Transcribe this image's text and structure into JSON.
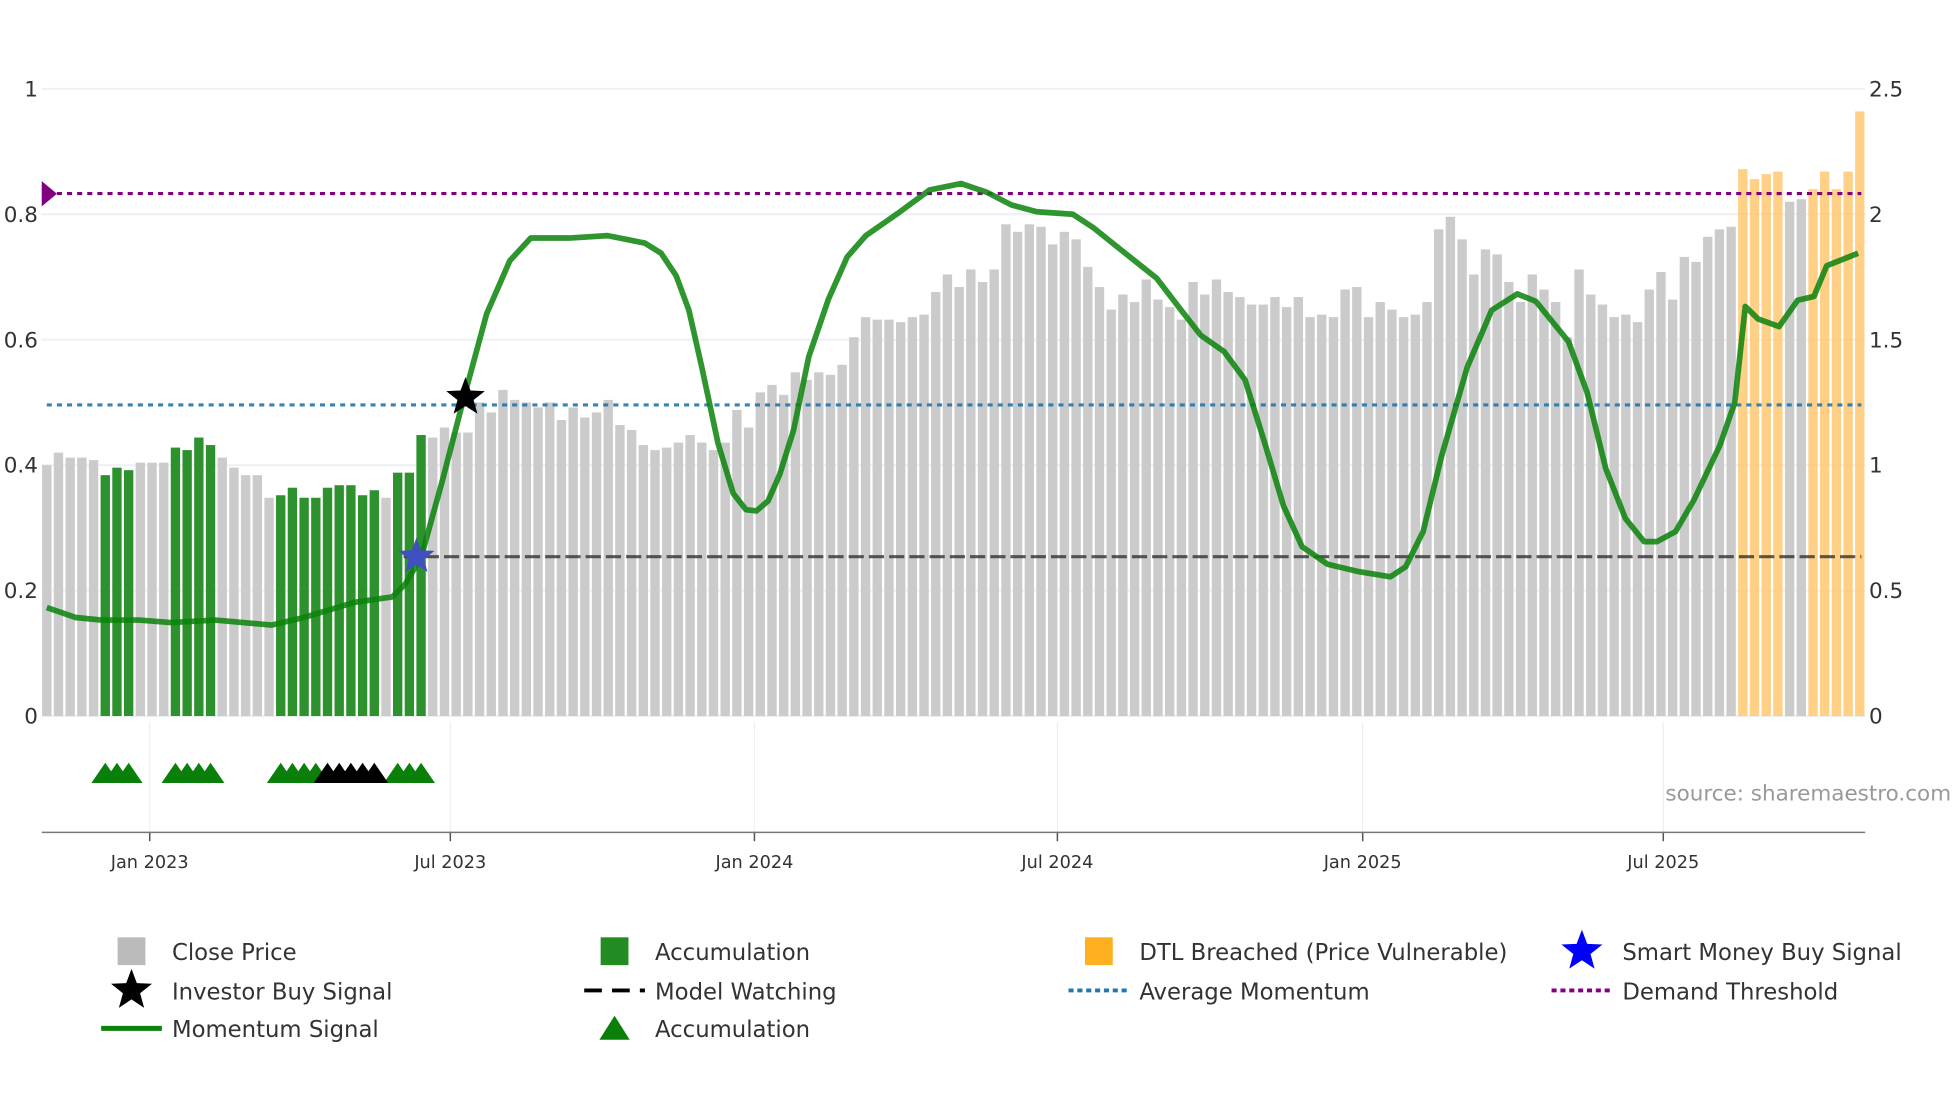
{
  "chart_data": {
    "type": "bar",
    "title": "",
    "x_unit": "week index",
    "x_ticks": [
      {
        "label": "Jan 2023",
        "index": 8.8
      },
      {
        "label": "Jul 2023",
        "index": 34.5
      },
      {
        "label": "Jan 2024",
        "index": 60.5
      },
      {
        "label": "Jul 2024",
        "index": 86.4
      },
      {
        "label": "Jan 2025",
        "index": 112.5
      },
      {
        "label": "Jul 2025",
        "index": 138.2
      }
    ],
    "y_left": {
      "ticks": [
        "0",
        "0.2",
        "0.4",
        "0.6",
        "0.8",
        "1"
      ],
      "values": [
        0,
        0.2,
        0.4,
        0.6,
        0.8,
        1
      ],
      "range": [
        0,
        1
      ]
    },
    "y_right": {
      "ticks": [
        "0",
        "0.5",
        "1",
        "1.5",
        "2",
        "2.5"
      ],
      "values": [
        0,
        0.5,
        1,
        1.5,
        2,
        2.5
      ],
      "range": [
        0,
        2.5
      ]
    },
    "close_price": [
      1.0,
      1.05,
      1.03,
      1.03,
      1.02,
      0.96,
      0.99,
      0.98,
      1.01,
      1.01,
      1.01,
      1.07,
      1.06,
      1.11,
      1.08,
      1.03,
      0.99,
      0.96,
      0.96,
      0.87,
      0.88,
      0.91,
      0.87,
      0.87,
      0.91,
      0.92,
      0.92,
      0.88,
      0.9,
      0.87,
      0.97,
      0.97,
      1.12,
      1.11,
      1.15,
      1.13,
      1.13,
      1.25,
      1.21,
      1.3,
      1.26,
      1.25,
      1.23,
      1.25,
      1.18,
      1.23,
      1.19,
      1.21,
      1.26,
      1.16,
      1.14,
      1.08,
      1.06,
      1.07,
      1.09,
      1.12,
      1.09,
      1.06,
      1.09,
      1.22,
      1.15,
      1.29,
      1.32,
      1.28,
      1.37,
      1.34,
      1.37,
      1.36,
      1.4,
      1.51,
      1.59,
      1.58,
      1.58,
      1.57,
      1.59,
      1.6,
      1.69,
      1.76,
      1.71,
      1.78,
      1.73,
      1.78,
      1.96,
      1.93,
      1.96,
      1.95,
      1.88,
      1.93,
      1.9,
      1.79,
      1.71,
      1.62,
      1.68,
      1.65,
      1.74,
      1.66,
      1.63,
      1.58,
      1.73,
      1.68,
      1.74,
      1.69,
      1.67,
      1.64,
      1.64,
      1.67,
      1.63,
      1.67,
      1.59,
      1.6,
      1.59,
      1.7,
      1.71,
      1.59,
      1.65,
      1.62,
      1.59,
      1.6,
      1.65,
      1.94,
      1.99,
      1.9,
      1.76,
      1.86,
      1.84,
      1.73,
      1.65,
      1.76,
      1.7,
      1.65,
      1.51,
      1.78,
      1.68,
      1.64,
      1.59,
      1.6,
      1.57,
      1.7,
      1.77,
      1.66,
      1.83,
      1.81,
      1.91,
      1.94,
      1.95,
      2.18,
      2.14,
      2.16,
      2.17,
      2.05,
      2.06,
      2.1,
      2.17,
      2.1,
      2.17,
      2.41
    ],
    "accumulation_bar_indices": [
      5,
      6,
      7,
      11,
      12,
      13,
      14,
      20,
      21,
      22,
      23,
      24,
      25,
      26,
      27,
      28,
      30,
      31,
      32
    ],
    "dtl_breached_bar_indices": [
      145,
      146,
      147,
      148,
      151,
      152,
      153,
      154,
      155
    ],
    "momentum": [
      [
        0,
        0.173
      ],
      [
        2.5,
        0.157
      ],
      [
        4.7,
        0.153
      ],
      [
        7.9,
        0.153
      ],
      [
        10.7,
        0.149
      ],
      [
        14.5,
        0.153
      ],
      [
        19.3,
        0.145
      ],
      [
        22.1,
        0.157
      ],
      [
        26.4,
        0.181
      ],
      [
        29.7,
        0.19
      ],
      [
        30.8,
        0.21
      ],
      [
        32.2,
        0.254
      ],
      [
        34,
        0.375
      ],
      [
        35.8,
        0.504
      ],
      [
        37.8,
        0.641
      ],
      [
        39.8,
        0.726
      ],
      [
        41.6,
        0.762
      ],
      [
        44.9,
        0.762
      ],
      [
        48.2,
        0.766
      ],
      [
        51.4,
        0.754
      ],
      [
        52.8,
        0.738
      ],
      [
        54.1,
        0.702
      ],
      [
        55.2,
        0.647
      ],
      [
        56.3,
        0.556
      ],
      [
        57.7,
        0.435
      ],
      [
        59,
        0.355
      ],
      [
        60.1,
        0.329
      ],
      [
        61,
        0.327
      ],
      [
        62,
        0.343
      ],
      [
        63,
        0.385
      ],
      [
        64.2,
        0.456
      ],
      [
        65.5,
        0.573
      ],
      [
        67.2,
        0.665
      ],
      [
        68.8,
        0.732
      ],
      [
        70.4,
        0.766
      ],
      [
        73.2,
        0.802
      ],
      [
        75.9,
        0.839
      ],
      [
        78.6,
        0.849
      ],
      [
        80.8,
        0.835
      ],
      [
        82.9,
        0.815
      ],
      [
        85.1,
        0.804
      ],
      [
        88.2,
        0.8
      ],
      [
        90,
        0.778
      ],
      [
        92.7,
        0.738
      ],
      [
        95.4,
        0.698
      ],
      [
        97.6,
        0.645
      ],
      [
        99.2,
        0.607
      ],
      [
        101.2,
        0.581
      ],
      [
        103,
        0.536
      ],
      [
        104.7,
        0.435
      ],
      [
        106.3,
        0.335
      ],
      [
        107.9,
        0.27
      ],
      [
        110.1,
        0.242
      ],
      [
        112.8,
        0.23
      ],
      [
        115.5,
        0.222
      ],
      [
        116.8,
        0.238
      ],
      [
        118.3,
        0.294
      ],
      [
        119.9,
        0.415
      ],
      [
        122.1,
        0.556
      ],
      [
        124.2,
        0.647
      ],
      [
        126.4,
        0.673
      ],
      [
        128,
        0.661
      ],
      [
        130.8,
        0.597
      ],
      [
        132.4,
        0.516
      ],
      [
        134,
        0.395
      ],
      [
        135.7,
        0.315
      ],
      [
        137.3,
        0.278
      ],
      [
        138.4,
        0.278
      ],
      [
        140,
        0.294
      ],
      [
        141.6,
        0.345
      ],
      [
        143.8,
        0.431
      ],
      [
        145.1,
        0.5
      ],
      [
        146,
        0.653
      ],
      [
        147.1,
        0.633
      ],
      [
        148.9,
        0.621
      ],
      [
        150.5,
        0.663
      ],
      [
        151.9,
        0.669
      ],
      [
        153,
        0.718
      ],
      [
        155.7,
        0.738
      ]
    ],
    "demand_threshold": 0.833,
    "average_momentum": 0.496,
    "model_watching": {
      "value": 0.254,
      "from_index": 30.5
    },
    "investor_buy_signal": {
      "index": 35.8,
      "value": 0.508
    },
    "smart_money_buy_signal": {
      "index": 31.6,
      "value": 0.254
    },
    "accumulation_markers_green": [
      5,
      6,
      7,
      11,
      12,
      13,
      14,
      20,
      21,
      22,
      23,
      30,
      31,
      32
    ],
    "accumulation_markers_black": [
      24,
      25,
      26,
      27,
      28
    ],
    "colors": {
      "price": "#c8c8c8",
      "accumulation": "#228b22",
      "dtl": "#ffc870",
      "momentum": "#0a830a",
      "avg": "#1f77b4",
      "demand": "#800080",
      "watch": "#333333",
      "smart": "#0000ff"
    },
    "legend": [
      {
        "label": "Close Price",
        "symbol": "gray-square"
      },
      {
        "label": "Accumulation",
        "symbol": "green-square"
      },
      {
        "label": "DTL Breached (Price Vulnerable)",
        "symbol": "orange-square"
      },
      {
        "label": "Smart Money Buy Signal",
        "symbol": "blue-star"
      },
      {
        "label": "Investor Buy Signal",
        "symbol": "black-star"
      },
      {
        "label": "Model Watching",
        "symbol": "black-dash"
      },
      {
        "label": "Average Momentum",
        "symbol": "blue-dot"
      },
      {
        "label": "Demand Threshold",
        "symbol": "purple-dot"
      },
      {
        "label": "Momentum Signal",
        "symbol": "green-line"
      },
      {
        "label": "Accumulation",
        "symbol": "green-triangle"
      }
    ],
    "source": "source: sharemaestro.com"
  }
}
